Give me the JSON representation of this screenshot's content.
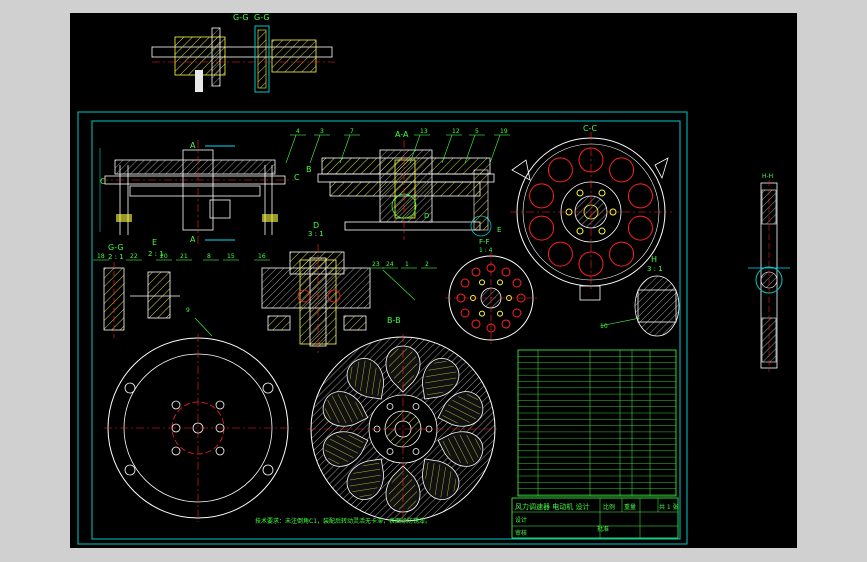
{
  "window": {
    "background": "#d0d0d0",
    "canvas_color": "#000000"
  },
  "colors": {
    "frame": "#00c8c8",
    "outline": "#ffffff",
    "center_line": "#ff2020",
    "hatch": "#ffff40",
    "dimension": "#40ff40",
    "text": "#40ff40",
    "cyan": "#00e0ff"
  },
  "views": {
    "gg_top_label": "G-G",
    "gg_top_label2": "G-G",
    "aa_label": "A-A",
    "cc_label": "C-C",
    "bb_label": "B-B",
    "gg_label": "G-G",
    "gg_scale": "2 : 1",
    "e_label": "E",
    "e_scale": "2 : 1",
    "d_label": "D",
    "d_scale": "3 : 1",
    "f_label": "F-F",
    "f_scale": "1 : 4",
    "h_label": "H",
    "h_scale": "3 : 1",
    "side_label": "H-H",
    "a_marker": "A",
    "b_marker": "B",
    "c_marker": "C"
  },
  "balloons": [
    "4",
    "3",
    "7",
    "13",
    "12",
    "5",
    "19",
    "18",
    "22",
    "20",
    "21",
    "11",
    "8",
    "15",
    "16",
    "14",
    "23",
    "24",
    "1",
    "2",
    "9",
    "10",
    "6",
    "17"
  ],
  "title_block": {
    "title": "风力调速器 电动机 设计",
    "company": "",
    "scale_label": "比例",
    "sheet_label": "共 1 张",
    "weight_label": "重量",
    "drawn": "设计",
    "checked": "审核",
    "approved": "批准"
  },
  "notes_text": "技术要求：未注倒角C1，装配后转动灵活无卡滞，表面涂防锈漆。"
}
